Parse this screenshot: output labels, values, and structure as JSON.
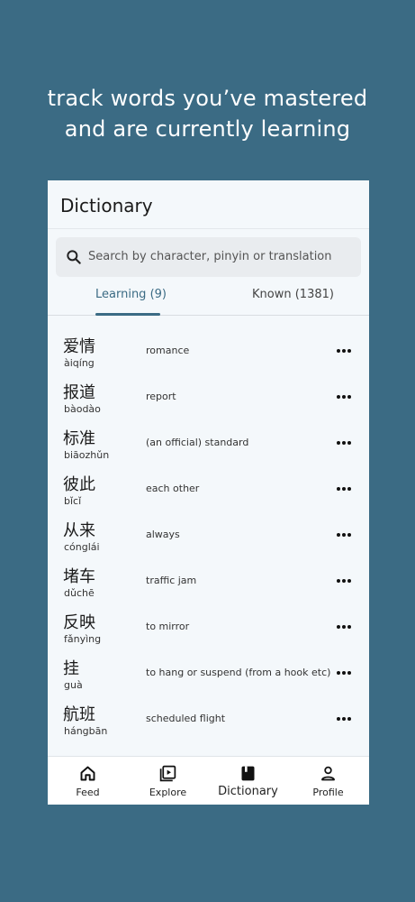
{
  "headline": {
    "line1": "track words you’ve mastered",
    "line2": "and are currently learning"
  },
  "header": {
    "title": "Dictionary"
  },
  "search": {
    "placeholder": "Search by character, pinyin or translation",
    "icon": "search-icon"
  },
  "tabs": [
    {
      "label": "Learning (9)",
      "active": true
    },
    {
      "label": "Known (1381)",
      "active": false
    }
  ],
  "words": [
    {
      "hanzi": "爱情",
      "pinyin": "àiqíng",
      "meaning": "romance"
    },
    {
      "hanzi": "报道",
      "pinyin": "bàodào",
      "meaning": "report"
    },
    {
      "hanzi": "标准",
      "pinyin": "biāozhǔn",
      "meaning": "(an official) standard"
    },
    {
      "hanzi": "彼此",
      "pinyin": "bǐcǐ",
      "meaning": "each other"
    },
    {
      "hanzi": "从来",
      "pinyin": "cónglái",
      "meaning": "always"
    },
    {
      "hanzi": "堵车",
      "pinyin": "dǔchē",
      "meaning": "traffic jam"
    },
    {
      "hanzi": "反映",
      "pinyin": "fǎnyìng",
      "meaning": "to mirror"
    },
    {
      "hanzi": "挂",
      "pinyin": "guà",
      "meaning": "to hang or suspend (from a hook etc)"
    },
    {
      "hanzi": "航班",
      "pinyin": "hángbān",
      "meaning": "scheduled flight"
    }
  ],
  "nav": [
    {
      "label": "Feed",
      "icon": "home-icon"
    },
    {
      "label": "Explore",
      "icon": "video-library-icon"
    },
    {
      "label": "Dictionary",
      "icon": "book-icon",
      "active": true
    },
    {
      "label": "Profile",
      "icon": "person-icon"
    }
  ],
  "colors": {
    "background": "#3b6b84",
    "accent": "#3b6b84",
    "panel": "#f4f8fb"
  }
}
